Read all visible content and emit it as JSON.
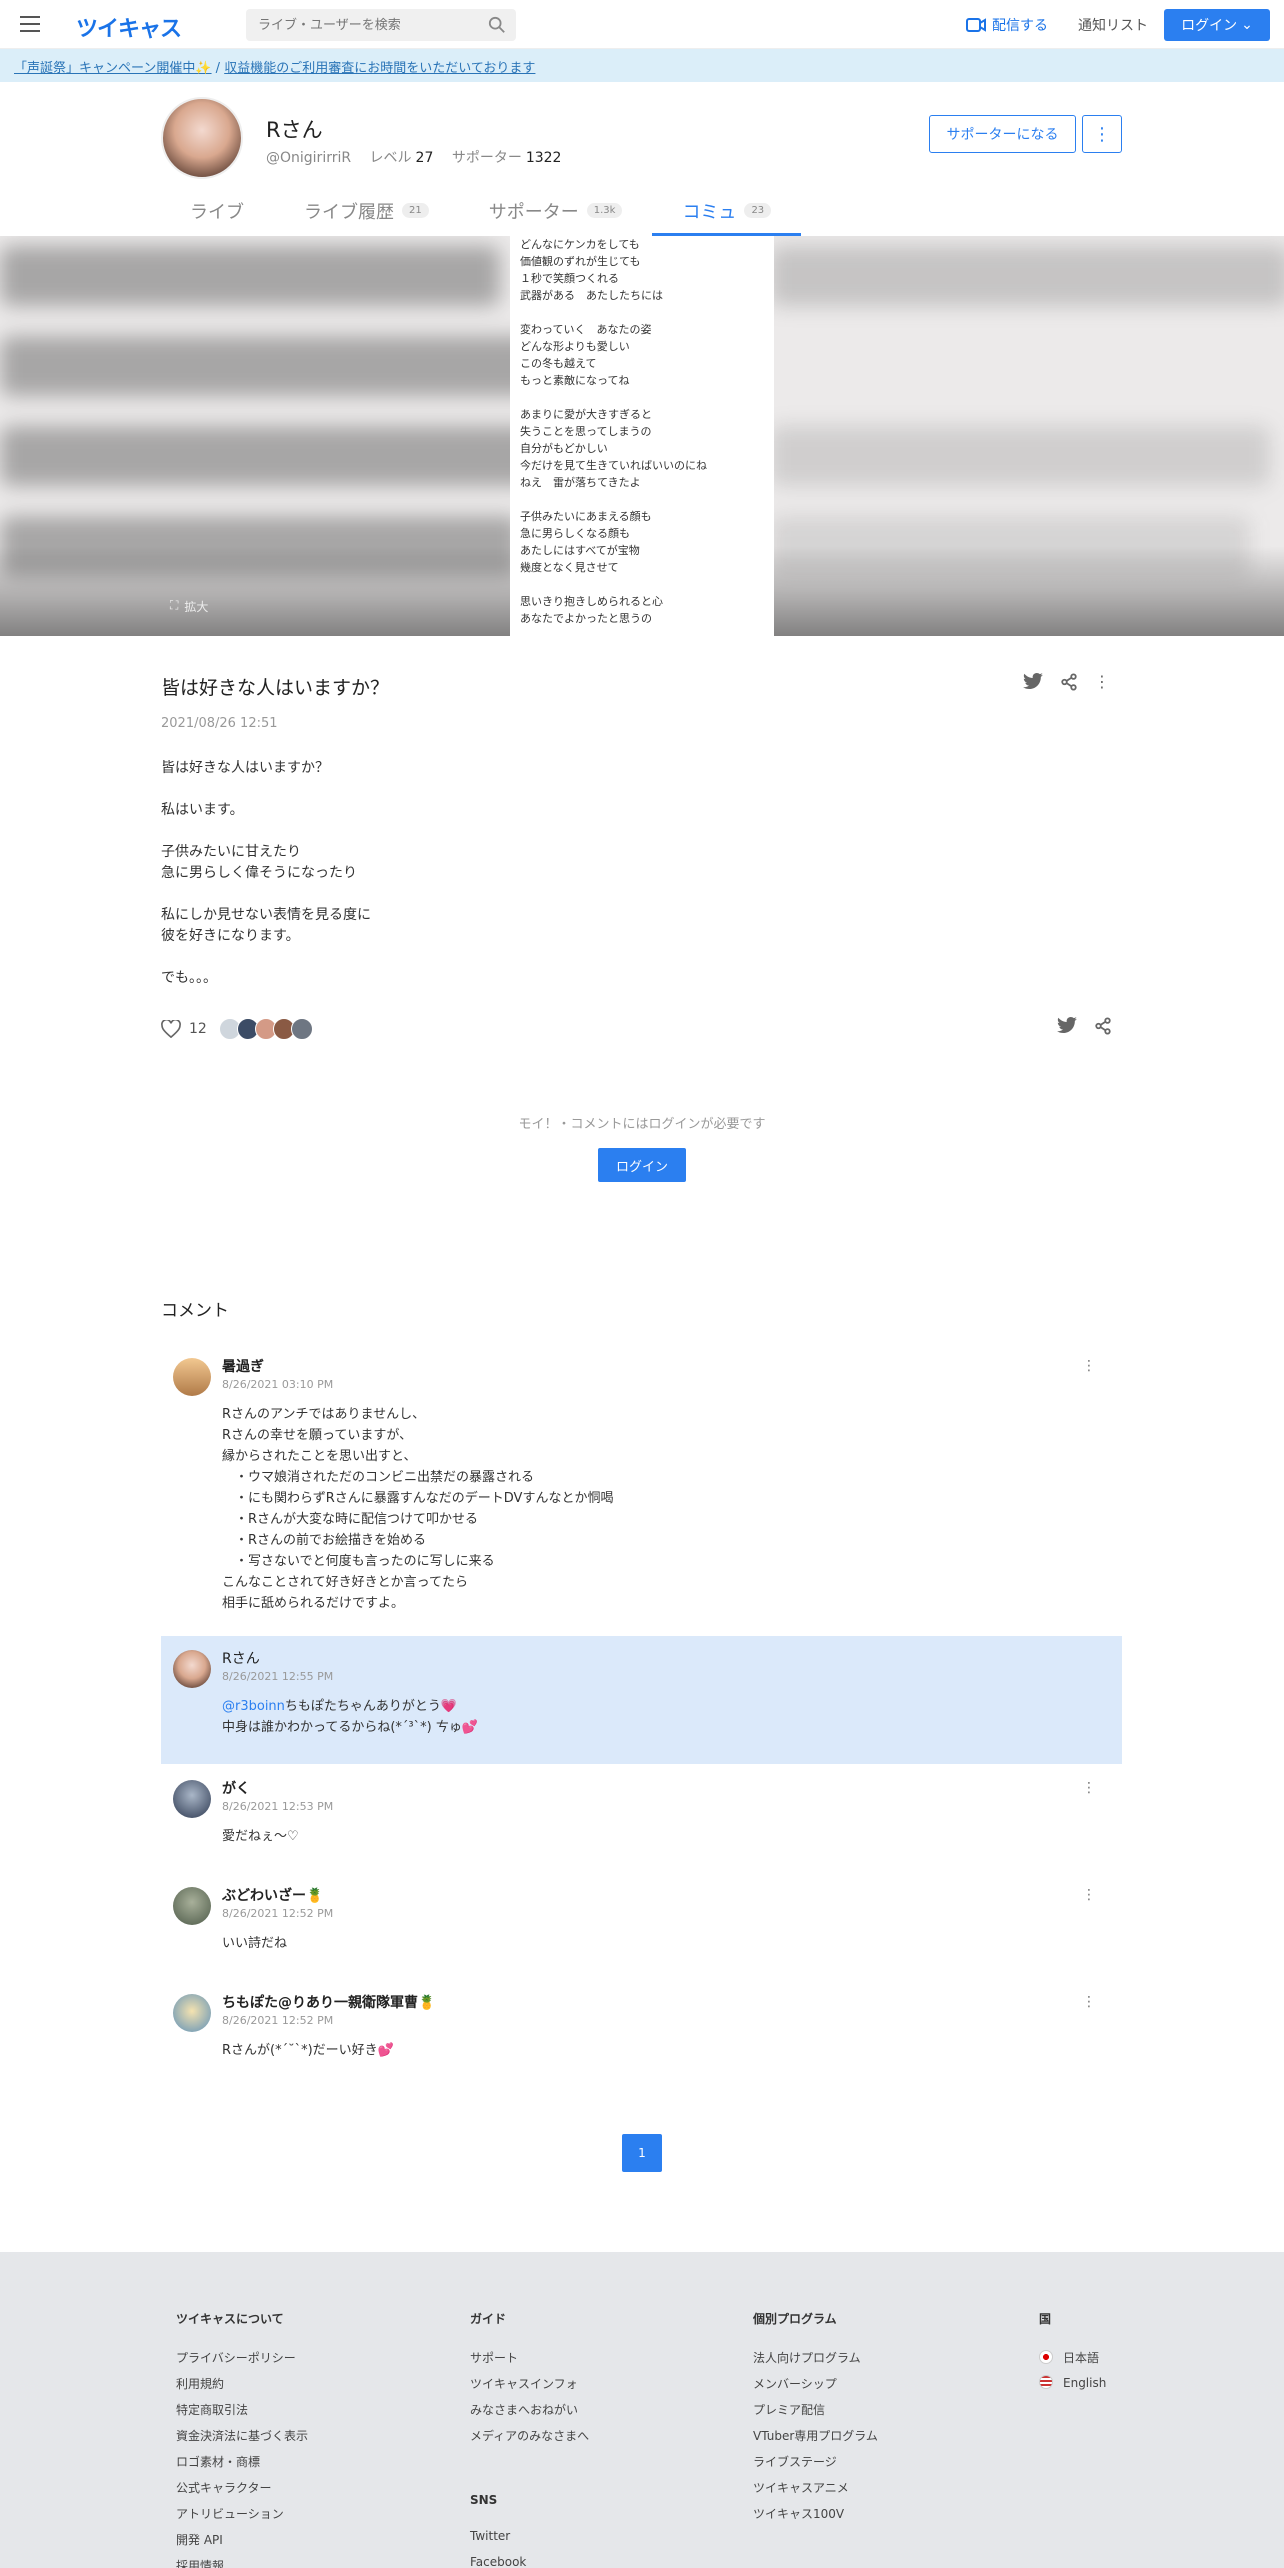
{
  "header": {
    "logo": "ツイキャス",
    "search_placeholder": "ライブ・ユーザーを検索",
    "stream_label": "配信する",
    "notify_label": "通知リスト",
    "login_label": "ログイン"
  },
  "banner": {
    "link1": "「声誕祭」キャンペーン開催中✨",
    "separator": " / ",
    "link2": "収益機能のご利用審査にお時間をいただいております"
  },
  "profile": {
    "name": "Rさん",
    "handle": "@OnigirirriR",
    "level_label": "レベル",
    "level": "27",
    "supporter_label": "サポーター",
    "supporters": "1322",
    "support_button": "サポーターになる"
  },
  "tabs": [
    {
      "label": "ライブ",
      "count": ""
    },
    {
      "label": "ライブ履歴",
      "count": "21"
    },
    {
      "label": "サポーター",
      "count": "1.3k"
    },
    {
      "label": "コミュ",
      "count": "23"
    }
  ],
  "hero": {
    "enlarge_label": "拡大",
    "lyrics": "どんなにケンカをしても\n価値観のずれが生じても\n１秒で笑顔つくれる\n武器がある　あたしたちには\n\n変わっていく　あなたの姿\nどんな形よりも愛しい\nこの冬も越えて\nもっと素敵になってね\n\nあまりに愛が大きすぎると\n失うことを思ってしまうの\n自分がもどかしい\n今だけを見て生きていればいいのにね\nねえ　雷が落ちてきたよ\n\n子供みたいにあまえる顔も\n急に男らしくなる顔も\nあたしにはすべてが宝物\n幾度となく見させて\n\n思いきり抱きしめられると心\nあなたでよかったと思うの"
  },
  "post": {
    "title": "皆は好きな人はいますか？",
    "date": "2021/08/26 12:51",
    "body": "皆は好きな人はいますか？\n\n私はいます。\n\n子供みたいに甘えたり\n急に男らしく偉そうになったり\n\n私にしか見せない表情を見る度に\n彼を好きになります。\n\nでも。。。",
    "likes": "12"
  },
  "login_prompt": {
    "note": "モイ！・コメントにはログインが必要です",
    "button": "ログイン"
  },
  "comments_title": "コメント",
  "comments": [
    {
      "name": "暑過ぎ",
      "time": "8/26/2021 03:10 PM",
      "text": "Rさんのアンチではありませんし、\nRさんの幸せを願っていますが、\n縁からされたことを思い出すと、\n　・ウマ娘消されただのコンビニ出禁だの暴露される\n　・にも関わらずRさんに暴露すんなだのデートDVすんなとか恫喝\n　・Rさんが大変な時に配信つけて叩かせる\n　・Rさんの前でお絵描きを始める\n　・写さないでと何度も言ったのに写しに来る\nこんなことされて好き好きとか言ってたら\n相手に舐められるだけですよ。"
    },
    {
      "name": "Rさん",
      "time": "8/26/2021 12:55 PM",
      "mention": "@r3boinn",
      "text": "ちもぽたちゃんありがとう💗\n中身は誰かわかってるからね(*´³`*) ㄘゅ💕"
    },
    {
      "name": "がく",
      "time": "8/26/2021 12:53 PM",
      "text": "愛だねぇ〜♡"
    },
    {
      "name": "ぶどわいざー🍍",
      "time": "8/26/2021 12:52 PM",
      "text": "いい詩だね"
    },
    {
      "name": "ちもぽた@りあり一親衛隊軍曹🍍",
      "time": "8/26/2021 12:52 PM",
      "text": "Rさんが(*´˘`*)だーい好き💕"
    }
  ],
  "pagination": {
    "current": "1"
  },
  "footer": {
    "col1": {
      "head": "ツイキャスについて",
      "items": [
        "プライバシーポリシー",
        "利用規約",
        "特定商取引法",
        "資金決済法に基づく表示",
        "ロゴ素材・商標",
        "公式キャラクター",
        "アトリビューション",
        "開発 API",
        "採用情報"
      ]
    },
    "col2": {
      "head": "ガイド",
      "items": [
        "サポート",
        "ツイキャスインフォ",
        "みなさまへおねがい",
        "メディアのみなさまへ"
      ],
      "sns_head": "SNS",
      "sns_items": [
        "Twitter",
        "Facebook"
      ]
    },
    "col3": {
      "head": "個別プログラム",
      "items": [
        "法人向けプログラム",
        "メンバーシップ",
        "プレミア配信",
        "VTuber専用プログラム",
        "ライブステージ",
        "ツイキャスアニメ",
        "ツイキャス100V"
      ]
    },
    "col4": {
      "head": "国",
      "items": [
        "日本語",
        "English"
      ]
    }
  }
}
